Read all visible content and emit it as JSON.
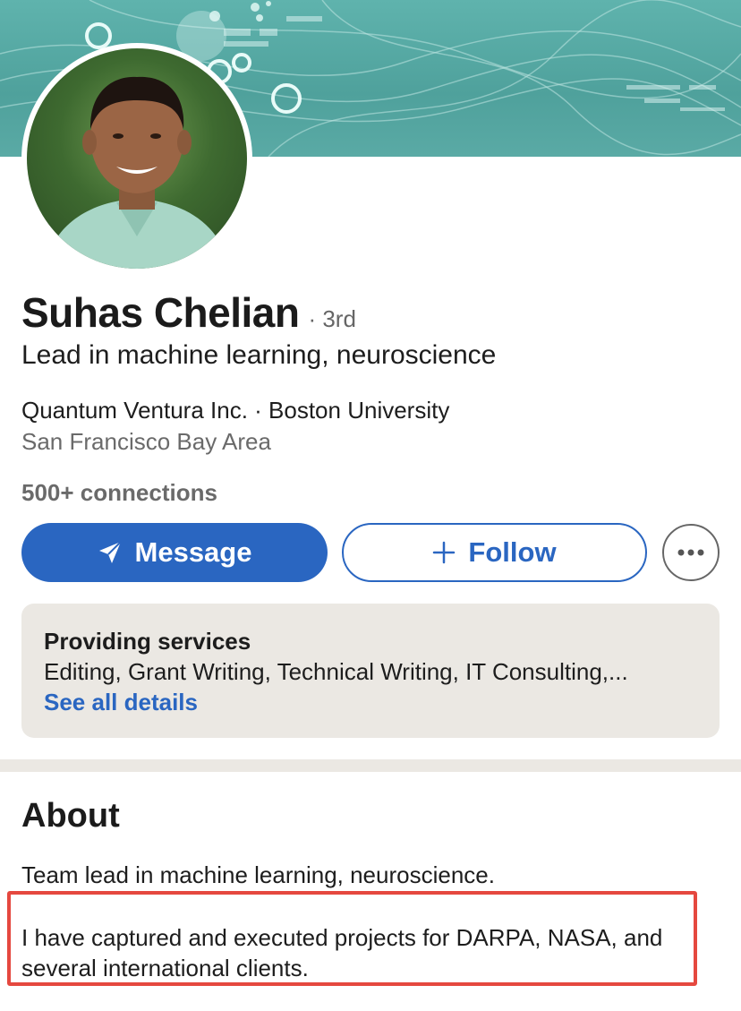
{
  "profile": {
    "name": "Suhas Chelian",
    "degree": "· 3rd",
    "headline": "Lead in machine learning, neuroscience",
    "company_school": "Quantum Ventura Inc. · Boston University",
    "location": "San Francisco Bay Area",
    "connections": "500+ connections"
  },
  "actions": {
    "message_label": "Message",
    "follow_label": "Follow",
    "message_icon": "paper-plane-icon",
    "follow_icon": "plus-icon",
    "more_icon": "ellipsis-icon"
  },
  "services": {
    "title": "Providing services",
    "list": "Editing, Grant Writing, Technical Writing, IT Consulting,...",
    "link": "See all details"
  },
  "about": {
    "title": "About",
    "paragraph1": "Team lead in machine learning, neuroscience.",
    "paragraph2": "I have captured and executed projects for DARPA, NASA, and several international clients."
  },
  "colors": {
    "primary": "#2a66c1",
    "highlight_border": "#e5483f",
    "services_bg": "#ebe8e3",
    "banner": "#5fb3ad"
  }
}
